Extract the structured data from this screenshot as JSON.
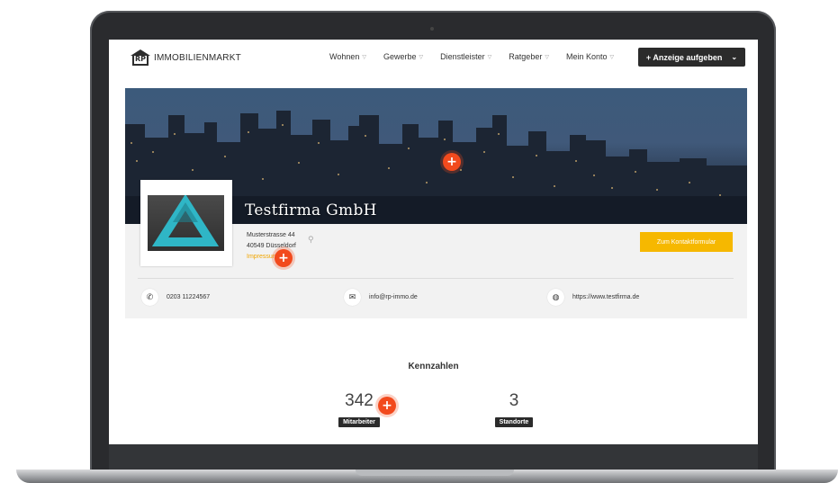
{
  "brand": {
    "logo_mark": "RP",
    "logo_text": "IMMOBILIENMARKT"
  },
  "nav": {
    "items": [
      {
        "label": "Wohnen"
      },
      {
        "label": "Gewerbe"
      },
      {
        "label": "Dienstleister"
      },
      {
        "label": "Ratgeber"
      },
      {
        "label": "Mein Konto"
      }
    ],
    "cta_label": "+ Anzeige aufgeben"
  },
  "profile": {
    "company_name": "Testfirma GmbH",
    "street": "Musterstrasse 44",
    "city": "40549 Düsseldorf",
    "impressum_label": "Impressum",
    "contact_button": "Zum Kontaktformular",
    "phone": "0203 11224567",
    "email": "info@rp-immo.de",
    "website": "https://www.testfirma.de"
  },
  "kennzahlen": {
    "title": "Kennzahlen",
    "stats": [
      {
        "value": "342",
        "label": "Mitarbeiter"
      },
      {
        "value": "3",
        "label": "Standorte"
      }
    ]
  },
  "colors": {
    "accent_yellow": "#f6b800",
    "marker_orange": "#f24a1d",
    "dark_button": "#2b2b2b"
  },
  "icons": {
    "phone": "phone-icon",
    "email": "envelope-icon",
    "web": "globe-icon",
    "location": "map-pin-icon",
    "plus": "plus-icon"
  }
}
